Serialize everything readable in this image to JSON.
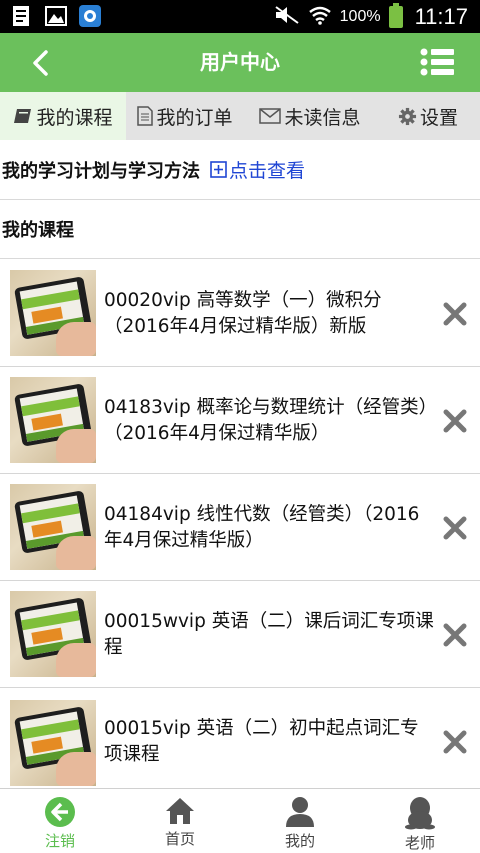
{
  "status_bar": {
    "battery_pct": "100%",
    "time": "11:17"
  },
  "header": {
    "title": "用户中心"
  },
  "tabs": [
    {
      "label": "我的课程",
      "icon": "book-icon"
    },
    {
      "label": "我的订单",
      "icon": "document-icon"
    },
    {
      "label": "未读信息",
      "icon": "envelope-icon"
    },
    {
      "label": "设置",
      "icon": "gear-icon"
    }
  ],
  "plan": {
    "text": "我的学习计划与学习方法",
    "link": "点击查看"
  },
  "section_title": "我的课程",
  "courses": [
    {
      "title": "00020vip 高等数学（一）微积分（2016年4月保过精华版）新版"
    },
    {
      "title": "04183vip 概率论与数理统计（经管类）（2016年4月保过精华版）"
    },
    {
      "title": "04184vip 线性代数（经管类）（2016年4月保过精华版）"
    },
    {
      "title": "00015wvip 英语（二）课后词汇专项课程"
    },
    {
      "title": "00015vip 英语（二）初中起点词汇专项课程"
    }
  ],
  "bottom_nav": [
    {
      "label": "注销",
      "icon": "logout-icon"
    },
    {
      "label": "首页",
      "icon": "home-icon"
    },
    {
      "label": "我的",
      "icon": "person-icon"
    },
    {
      "label": "老师",
      "icon": "penguin-icon"
    }
  ],
  "colors": {
    "accent": "#6bc05c",
    "link": "#2046d4",
    "tab_bg": "#e3e3e3"
  }
}
